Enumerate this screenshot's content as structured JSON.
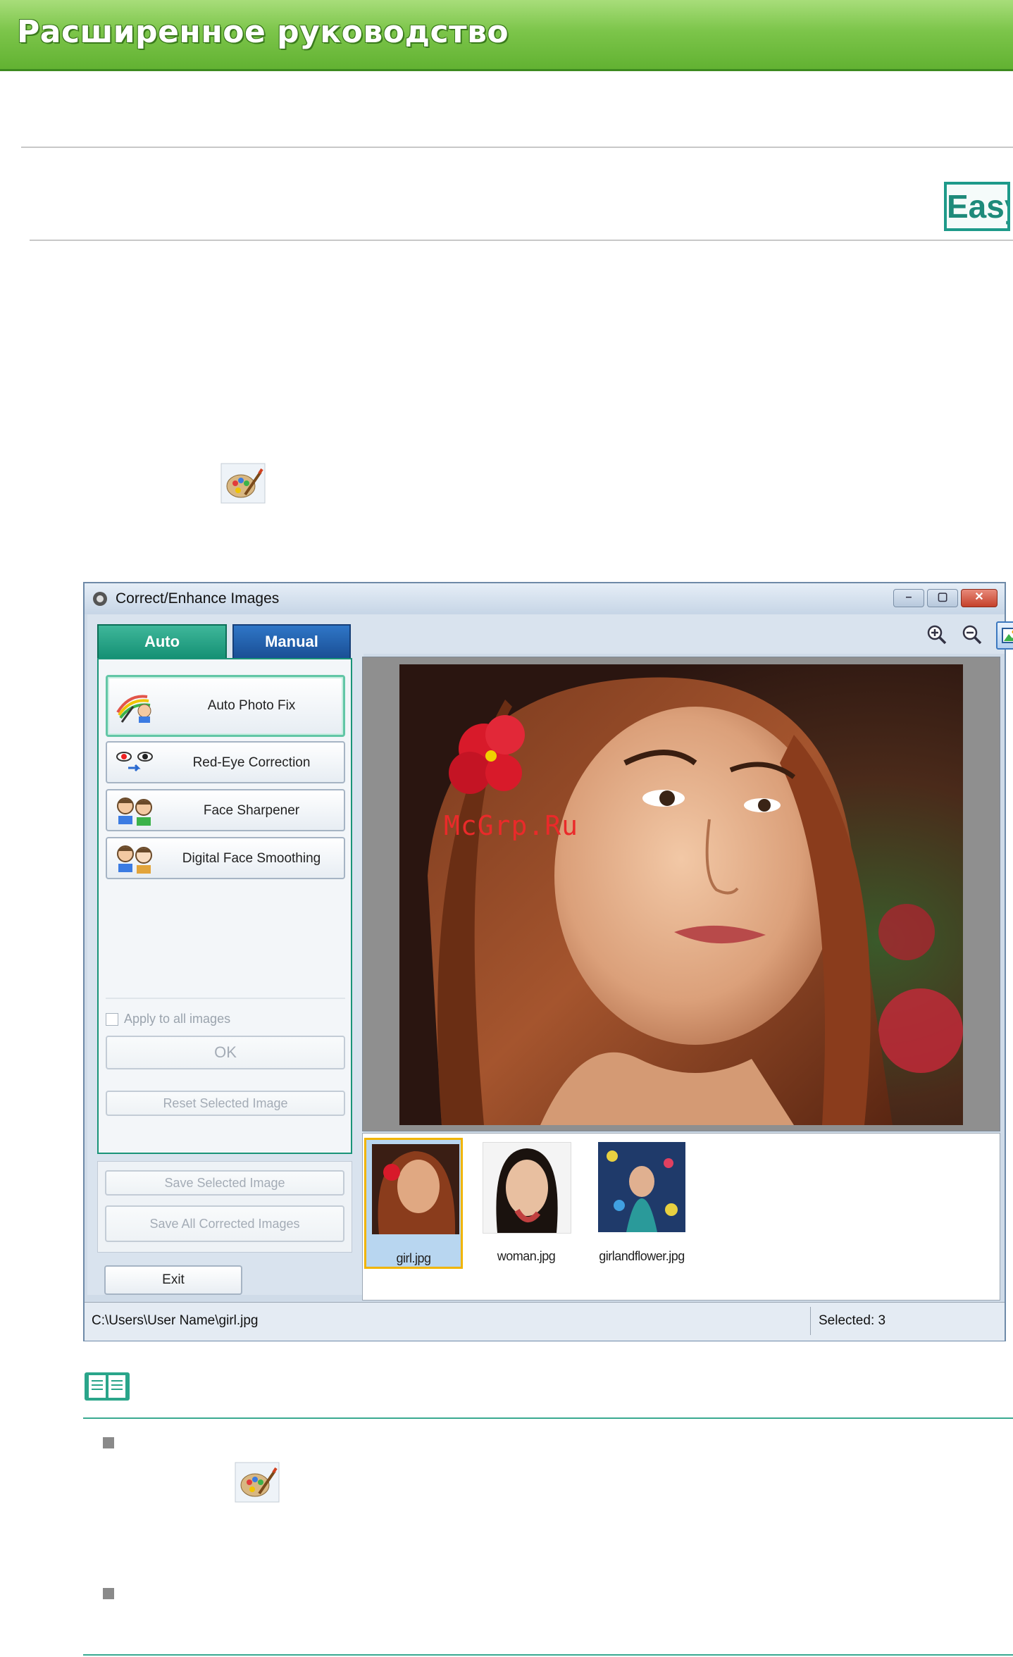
{
  "header": {
    "title": "Расширенное руководство"
  },
  "badge": {
    "label": "Easy"
  },
  "window": {
    "title": "Correct/Enhance Images",
    "controls": {
      "minimize": "–",
      "maximize": "▢",
      "close": "✕"
    },
    "tabs": {
      "auto": "Auto",
      "manual": "Manual"
    },
    "functions": [
      {
        "label": "Auto Photo Fix"
      },
      {
        "label": "Red-Eye Correction"
      },
      {
        "label": "Face Sharpener"
      },
      {
        "label": "Digital Face Smoothing"
      }
    ],
    "apply_all_label": "Apply to all images",
    "ok_label": "OK",
    "reset_label": "Reset Selected Image",
    "save_selected_label": "Save Selected Image",
    "save_all_label": "Save All Corrected Images",
    "exit_label": "Exit",
    "thumbnails": [
      {
        "label": "girl.jpg",
        "selected": true
      },
      {
        "label": "woman.jpg",
        "selected": false
      },
      {
        "label": "girlandflower.jpg",
        "selected": false
      }
    ],
    "status": {
      "path": "C:\\Users\\User Name\\girl.jpg",
      "selected": "Selected: 3"
    }
  },
  "watermark": "McGrp.Ru",
  "colors": {
    "accent_green": "#1e9a8a",
    "banner_green": "#7cc54a",
    "tab_auto": "#138f73",
    "tab_manual": "#1a4f95"
  }
}
